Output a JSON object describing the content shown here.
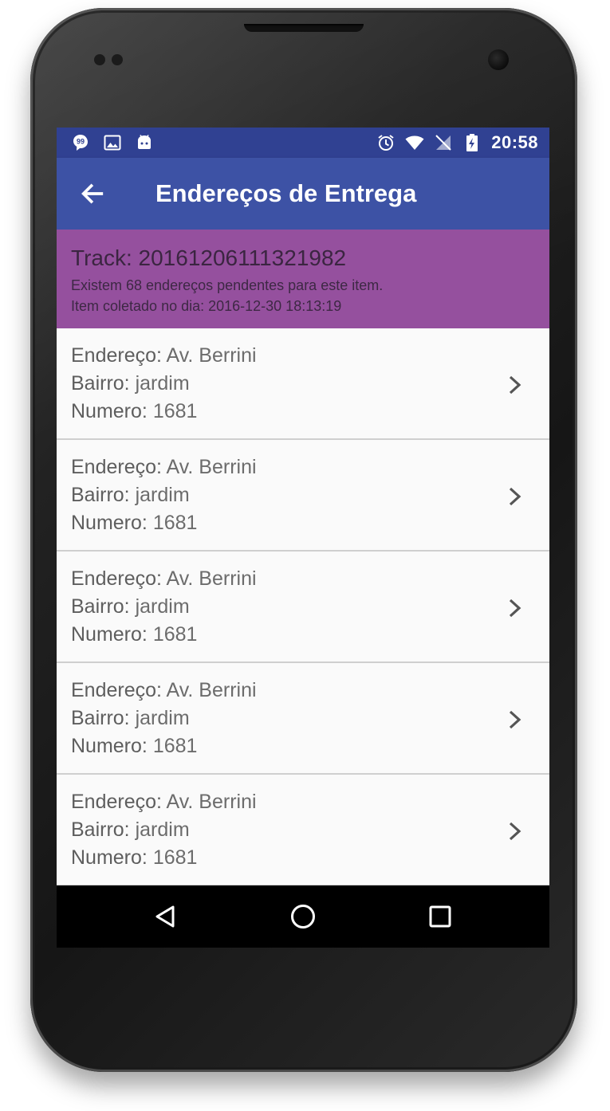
{
  "status_bar": {
    "time": "20:58",
    "left_icons": [
      "chat-bubble-icon",
      "image-icon",
      "android-icon"
    ],
    "right_icons": [
      "alarm-icon",
      "wifi-icon",
      "no-signal-icon",
      "battery-charging-icon"
    ]
  },
  "app_bar": {
    "title": "Endereços de Entrega",
    "back_icon": "arrow-left-icon"
  },
  "track": {
    "label": "Track:",
    "value": "20161206111321982",
    "pending_text": "Existem 68 endereços pendentes para este item.",
    "collected_text": "Item coletado no dia: 2016-12-30 18:13:19"
  },
  "field_labels": {
    "endereco": "Endereço:",
    "bairro": "Bairro:",
    "numero": "Numero:"
  },
  "addresses": [
    {
      "endereco": "Av. Berrini",
      "bairro": "jardim",
      "numero": "1681"
    },
    {
      "endereco": "Av. Berrini",
      "bairro": "jardim",
      "numero": "1681"
    },
    {
      "endereco": "Av. Berrini",
      "bairro": "jardim",
      "numero": "1681"
    },
    {
      "endereco": "Av. Berrini",
      "bairro": "jardim",
      "numero": "1681"
    },
    {
      "endereco": "Av. Berrini",
      "bairro": "jardim",
      "numero": "1681"
    }
  ],
  "nav_bar": [
    "back-triangle-icon",
    "home-circle-icon",
    "recents-square-icon"
  ],
  "colors": {
    "status_bar": "#304192",
    "app_bar": "#3d52a5",
    "track_panel": "#95509e",
    "list_bg": "#fafafa"
  }
}
